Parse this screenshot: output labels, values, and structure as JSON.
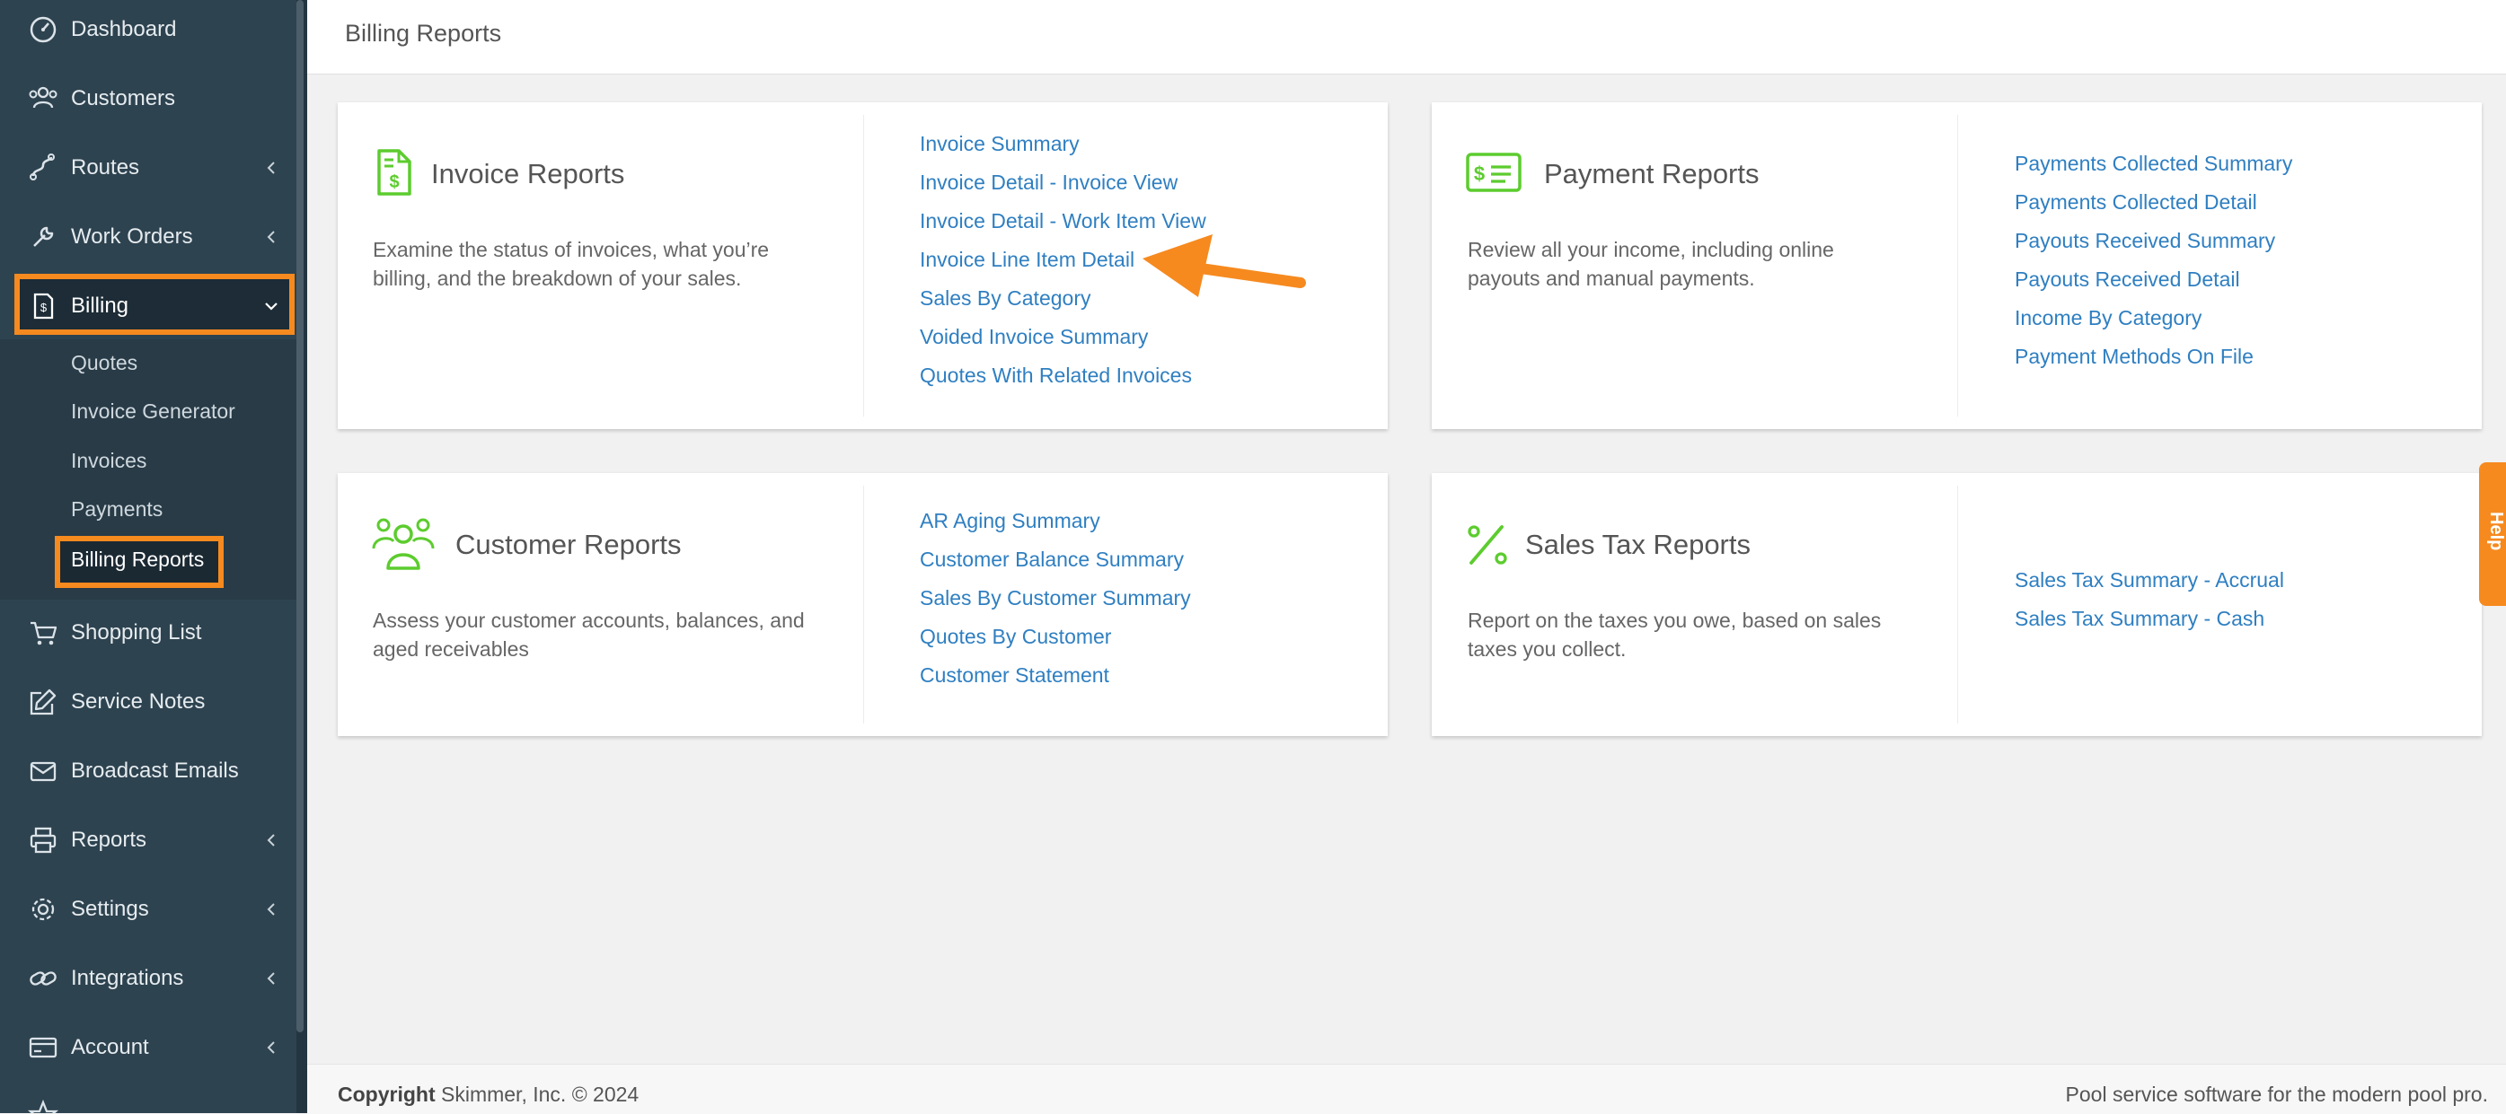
{
  "sidebar": {
    "items": [
      {
        "label": "Dashboard",
        "icon": "dashboard-icon"
      },
      {
        "label": "Customers",
        "icon": "customers-icon"
      },
      {
        "label": "Routes",
        "icon": "routes-icon"
      },
      {
        "label": "Work Orders",
        "icon": "wrench-icon"
      },
      {
        "label": "Billing",
        "icon": "invoice-icon"
      },
      {
        "label": "Shopping List",
        "icon": "cart-icon"
      },
      {
        "label": "Service Notes",
        "icon": "edit-icon"
      },
      {
        "label": "Broadcast Emails",
        "icon": "envelope-icon"
      },
      {
        "label": "Reports",
        "icon": "printer-icon"
      },
      {
        "label": "Settings",
        "icon": "gear-icon"
      },
      {
        "label": "Integrations",
        "icon": "link-icon"
      },
      {
        "label": "Account",
        "icon": "card-icon"
      }
    ],
    "billing_submenu": [
      "Quotes",
      "Invoice Generator",
      "Invoices",
      "Payments",
      "Billing Reports"
    ]
  },
  "header": {
    "title": "Billing Reports"
  },
  "cards": {
    "invoice": {
      "title": "Invoice Reports",
      "description": "Examine the status of invoices, what you’re billing, and the breakdown of your sales.",
      "links": [
        "Invoice Summary",
        "Invoice Detail - Invoice View",
        "Invoice Detail - Work Item View",
        "Invoice Line Item Detail",
        "Sales By Category",
        "Voided Invoice Summary",
        "Quotes With Related Invoices"
      ]
    },
    "payment": {
      "title": "Payment Reports",
      "description": "Review all your income, including online payouts and manual payments.",
      "links": [
        "Payments Collected Summary",
        "Payments Collected Detail",
        "Payouts Received Summary",
        "Payouts Received Detail",
        "Income By Category",
        "Payment Methods On File"
      ]
    },
    "customer": {
      "title": "Customer Reports",
      "description": "Assess your customer accounts, balances, and aged receivables",
      "links": [
        "AR Aging Summary",
        "Customer Balance Summary",
        "Sales By Customer Summary",
        "Quotes By Customer",
        "Customer Statement"
      ]
    },
    "salestax": {
      "title": "Sales Tax Reports",
      "description": "Report on the taxes you owe, based on sales taxes you collect.",
      "links": [
        "Sales Tax Summary - Accrual",
        "Sales Tax Summary - Cash"
      ]
    }
  },
  "help": {
    "label": "Help"
  },
  "footer": {
    "copyright_label": "Copyright",
    "copyright_text": " Skimmer, Inc. © 2024",
    "tagline": "Pool service software for the modern pool pro."
  },
  "colors": {
    "accent": "#f68a1f",
    "link": "#2f7fc1",
    "icon_green": "#5ccc2e",
    "sidebar": "#2e4350"
  }
}
